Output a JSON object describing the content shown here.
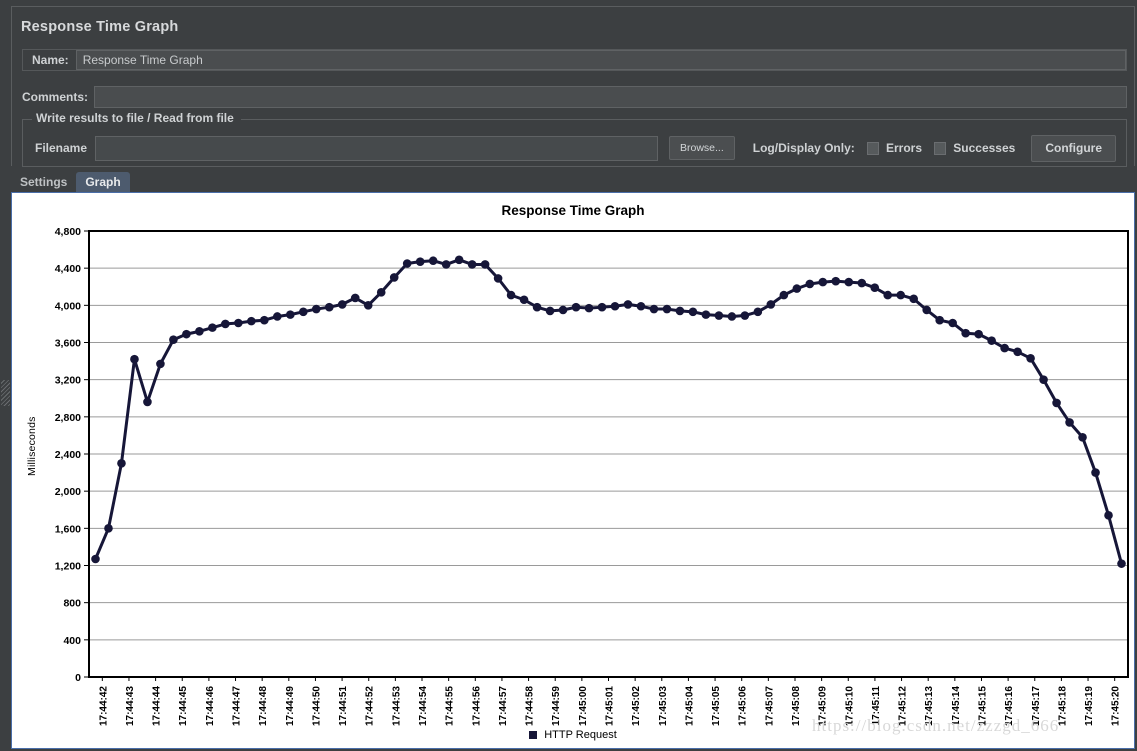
{
  "window": {
    "title": "Response Time Graph"
  },
  "form": {
    "name_label": "Name:",
    "name_value": "Response Time Graph",
    "comments_label": "Comments:",
    "comments_value": "",
    "fieldset_legend": "Write results to file / Read from file",
    "filename_label": "Filename",
    "filename_value": "",
    "browse_label": "Browse...",
    "logdisplay_label": "Log/Display Only:",
    "errors_label": "Errors",
    "errors_checked": false,
    "successes_label": "Successes",
    "successes_checked": false,
    "configure_label": "Configure"
  },
  "tabs": [
    {
      "label": "Settings",
      "active": false
    },
    {
      "label": "Graph",
      "active": true
    }
  ],
  "colors": {
    "series": "#161638",
    "panel_bg": "#3c3f41",
    "tab_active_bg": "#4d5b6e",
    "chart_border": "#4a6ea9",
    "gridline": "#9a9a9a",
    "axis": "#000000"
  },
  "watermark": "https://blog.csdn.net/zzzgd_666",
  "chart_data": {
    "type": "line",
    "title": "Response Time Graph",
    "xlabel": "",
    "ylabel": "Milliseconds",
    "legend": [
      "HTTP Request"
    ],
    "legend_position": "bottom",
    "grid": true,
    "ylim": [
      0,
      4800
    ],
    "yticks": [
      0,
      400,
      800,
      1200,
      1600,
      2000,
      2400,
      2800,
      3200,
      3600,
      4000,
      4400,
      4800
    ],
    "ytick_labels": [
      "0",
      "400",
      "800",
      "1,200",
      "1,600",
      "2,000",
      "2,400",
      "2,800",
      "3,200",
      "3,600",
      "4,000",
      "4,400",
      "4,800"
    ],
    "xtick_labels": [
      "17:44:42",
      "17:44:43",
      "17:44:44",
      "17:44:45",
      "17:44:46",
      "17:44:47",
      "17:44:48",
      "17:44:49",
      "17:44:50",
      "17:44:51",
      "17:44:52",
      "17:44:53",
      "17:44:54",
      "17:44:55",
      "17:44:56",
      "17:44:57",
      "17:44:58",
      "17:44:59",
      "17:45:00",
      "17:45:01",
      "17:45:02",
      "17:45:03",
      "17:45:04",
      "17:45:05",
      "17:45:06",
      "17:45:07",
      "17:45:08",
      "17:45:09",
      "17:45:10",
      "17:45:11",
      "17:45:12",
      "17:45:13",
      "17:45:14",
      "17:45:15",
      "17:45:16",
      "17:45:17",
      "17:45:18",
      "17:45:19",
      "17:45:20"
    ],
    "series": [
      {
        "name": "HTTP Request",
        "color": "#161638",
        "values": [
          1270,
          1600,
          2300,
          3420,
          2960,
          3370,
          3630,
          3690,
          3720,
          3760,
          3800,
          3810,
          3830,
          3840,
          3880,
          3900,
          3930,
          3960,
          3980,
          4010,
          4080,
          4000,
          4140,
          4300,
          4450,
          4470,
          4480,
          4440,
          4490,
          4440,
          4440,
          4290,
          4110,
          4060,
          3980,
          3940,
          3950,
          3980,
          3970,
          3980,
          3990,
          4010,
          3990,
          3960,
          3960,
          3940,
          3930,
          3900,
          3890,
          3880,
          3890,
          3930,
          4010,
          4110,
          4180,
          4230,
          4250,
          4260,
          4250,
          4240,
          4190,
          4110,
          4110,
          4070,
          3950,
          3840,
          3810,
          3700,
          3690,
          3620,
          3540,
          3500,
          3430,
          3200,
          2950,
          2740,
          2580,
          2200,
          1740,
          1220
        ]
      }
    ]
  }
}
